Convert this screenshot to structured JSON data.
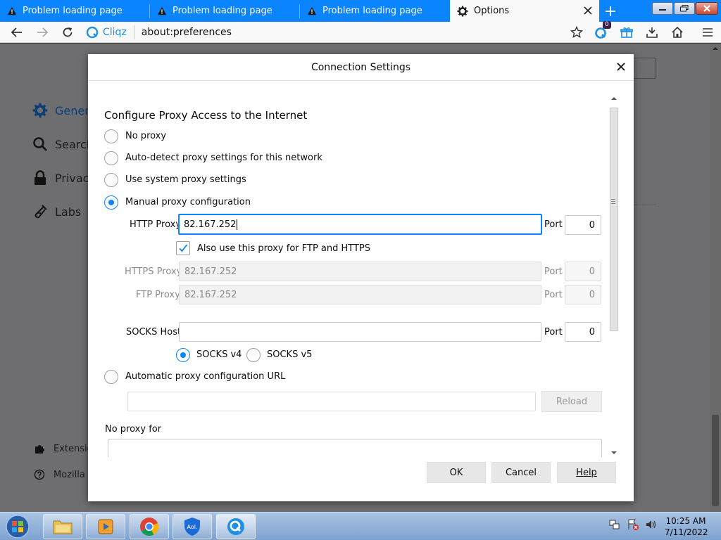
{
  "browser": {
    "tabs": [
      {
        "title": "Problem loading page",
        "icon": "warning-icon"
      },
      {
        "title": "Problem loading page",
        "icon": "warning-icon"
      },
      {
        "title": "Problem loading page",
        "icon": "warning-icon"
      },
      {
        "title": "Options",
        "icon": "gear-icon",
        "active": true
      }
    ],
    "address": {
      "brand": "Cliqz",
      "url": "about:preferences"
    },
    "badge_count": "0"
  },
  "sidebar": {
    "items": [
      {
        "label": "Genera",
        "icon": "gear-icon"
      },
      {
        "label": "Search",
        "icon": "search-icon"
      },
      {
        "label": "Privacy",
        "icon": "lock-icon"
      },
      {
        "label": "Labs",
        "icon": "flask-icon"
      }
    ],
    "footer": [
      {
        "label": "Extensio",
        "icon": "puzzle-icon"
      },
      {
        "label": "Mozilla",
        "icon": "help-icon"
      }
    ]
  },
  "dialog": {
    "title": "Connection Settings",
    "section_title": "Configure Proxy Access to the Internet",
    "options": {
      "no_proxy": "No proxy",
      "auto_detect": "Auto-detect proxy settings for this network",
      "system": "Use system proxy settings",
      "manual": "Manual proxy configuration",
      "auto_url": "Automatic proxy configuration URL"
    },
    "selected_option": "manual",
    "http": {
      "label": "HTTP Proxy",
      "value": "82.167.252",
      "port_label": "Port",
      "port": "0"
    },
    "share_checkbox": {
      "label": "Also use this proxy for FTP and HTTPS",
      "checked": true
    },
    "https": {
      "label": "HTTPS Proxy",
      "value": "82.167.252",
      "port_label": "Port",
      "port": "0"
    },
    "ftp": {
      "label": "FTP Proxy",
      "value": "82.167.252",
      "port_label": "Port",
      "port": "0"
    },
    "socks": {
      "label": "SOCKS Host",
      "value": "",
      "port_label": "Port",
      "port": "0",
      "v4": "SOCKS v4",
      "v5": "SOCKS v5",
      "selected": "v4"
    },
    "auto_url": {
      "value": "",
      "reload": "Reload"
    },
    "no_proxy_for": {
      "label": "No proxy for",
      "value": ""
    },
    "buttons": {
      "ok": "OK",
      "cancel": "Cancel",
      "help": "Help"
    }
  },
  "taskbar": {
    "time": "10:25 AM",
    "date": "7/11/2022"
  },
  "colors": {
    "accent": "#0a84ff",
    "tabstrip": "#0a84ff",
    "taskbar": "#8fb0d8"
  }
}
